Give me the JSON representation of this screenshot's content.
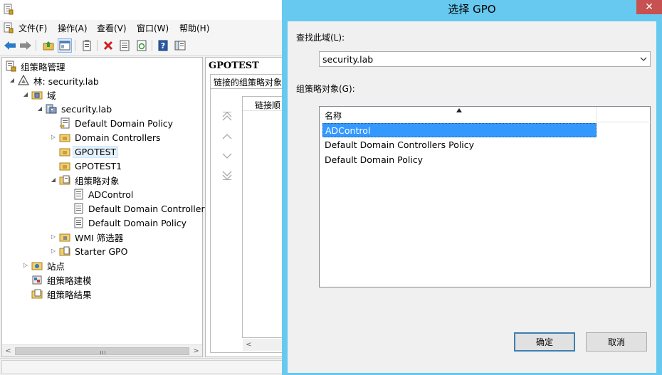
{
  "gpmc": {
    "menu": [
      {
        "label": "文件(F)"
      },
      {
        "label": "操作(A)"
      },
      {
        "label": "查看(V)"
      },
      {
        "label": "窗口(W)"
      },
      {
        "label": "帮助(H)"
      }
    ],
    "toolbar_icons": [
      "back-arrow-icon",
      "forward-arrow-icon",
      "up-folder-icon",
      "show-hide-tree-icon",
      "clipboard-icon",
      "delete-icon",
      "properties-icon",
      "refresh-icon",
      "help-icon",
      "console-tree-icon"
    ],
    "tree": {
      "root": "组策略管理",
      "forest": "林: security.lab",
      "domains": "域",
      "domain": "security.lab",
      "default_domain_policy": "Default Domain Policy",
      "domain_controllers": "Domain Controllers",
      "gpotest": "GPOTEST",
      "gpotest1": "GPOTEST1",
      "gpo_container": "组策略对象",
      "gpo_adcontrol": "ADControl",
      "gpo_ddcp": "Default Domain Controllers",
      "gpo_ddp": "Default Domain Policy",
      "wmi_filters": "WMI 筛选器",
      "starter_gpo": "Starter GPO",
      "sites": "站点",
      "modeling": "组策略建模",
      "results": "组策略结果"
    },
    "detail": {
      "title": "GPOTEST",
      "tab": "链接的组策略对象",
      "column_header": "链接顺"
    }
  },
  "dialog": {
    "title": "选择 GPO",
    "close_glyph": "✕",
    "domain_label": "查找此域(L):",
    "domain_value": "security.lab",
    "gpo_label": "组策略对象(G):",
    "column_name": "名称",
    "gpos": [
      "ADControl",
      "Default Domain Controllers Policy",
      "Default Domain Policy"
    ],
    "selected_index": 0,
    "ok_label": "确定",
    "cancel_label": "取消"
  },
  "colors": {
    "dialog_frame": "#67c9ef",
    "selection": "#3399ff",
    "close_button": "#c75050"
  }
}
